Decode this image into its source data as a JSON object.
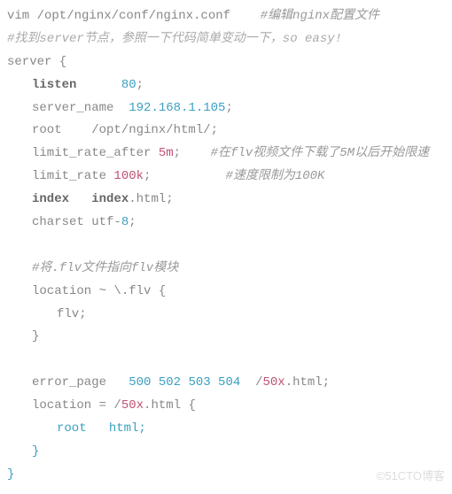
{
  "top": {
    "cmd": "vim /opt/nginx/conf/nginx.conf",
    "cmt1": "#编辑nginx配置文件",
    "cmt2": "#找到server节点，参照一下代码简单变动一下，so easy!"
  },
  "server": {
    "open": "server {",
    "listen_kw": "listen",
    "listen_val": "80",
    "servername_kw": "server_name",
    "servername_val": "192.168.1.105",
    "root_kw": "root",
    "root_val": "/opt/nginx/html/",
    "lra_kw": "limit_rate_after",
    "lra_val": "5m",
    "lra_cmt": "#在flv视频文件下载了5M以后开始限速",
    "lr_kw": "limit_rate",
    "lr_val": "100k",
    "lr_cmt": "#速度限制为100K",
    "index_kw": "index",
    "index_val1": "index",
    "index_val2": ".html;",
    "charset_kw": "charset utf-",
    "charset_val": "8",
    "flv_cmt": "#将.flv文件指向flv模块",
    "loc1_kw": "location ~ \\",
    "loc1_ext": ".flv",
    "loc1_open": " {",
    "loc1_body": "flv;",
    "loc1_close": "}",
    "err_kw": "error_page",
    "err_codes": "500 502 503 504",
    "err_slash": "/",
    "err_file": "50x",
    "err_ext": ".html;",
    "loc2_kw": "location = /",
    "loc2_file": "50x",
    "loc2_ext": ".html",
    "loc2_open": " {",
    "loc2_root_kw": "root",
    "loc2_root_val": "html;",
    "loc2_close": "}",
    "close": "}"
  },
  "watermark": "©51CTO博客"
}
